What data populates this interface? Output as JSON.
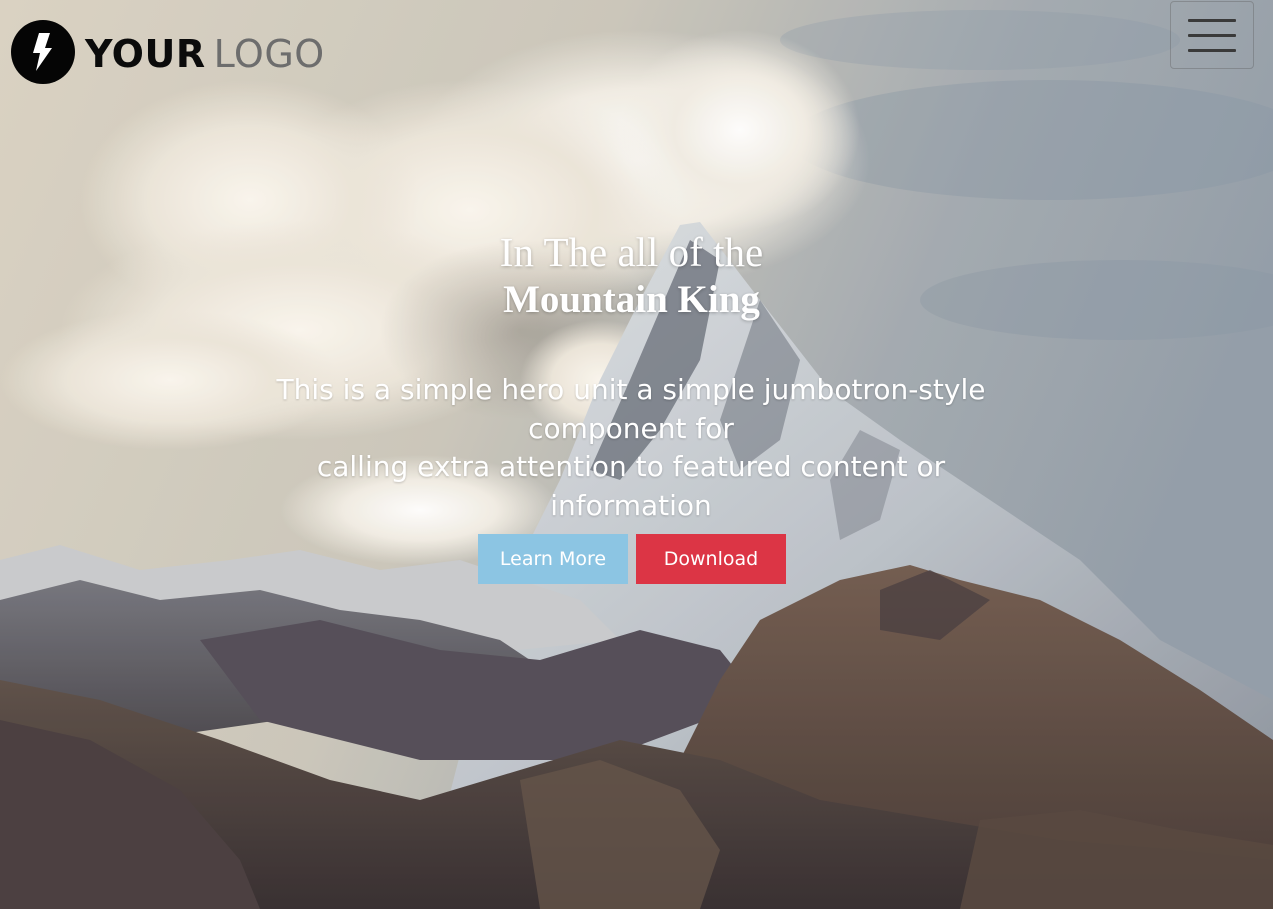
{
  "brand": {
    "logo_strong": "YOUR",
    "logo_light": "LOGO",
    "mark_icon": "lightning-bolt-icon"
  },
  "nav": {
    "toggle_icon": "hamburger-menu-icon"
  },
  "hero": {
    "title_line1": "In The all of the",
    "title_line2": "Mountain King",
    "lead_line1": "This is a simple hero unit a simple jumbotron-style component for",
    "lead_line2": "calling extra attention to featured content or information",
    "background": "snowy-mountain-peak-with-clouds"
  },
  "actions": {
    "learn_more_label": "Learn More",
    "download_label": "Download"
  },
  "colors": {
    "learn_more_bg": "#8cc5e3",
    "download_bg": "#dc3545",
    "logo_dark": "#050505",
    "logo_gray": "#6d6d6d"
  }
}
